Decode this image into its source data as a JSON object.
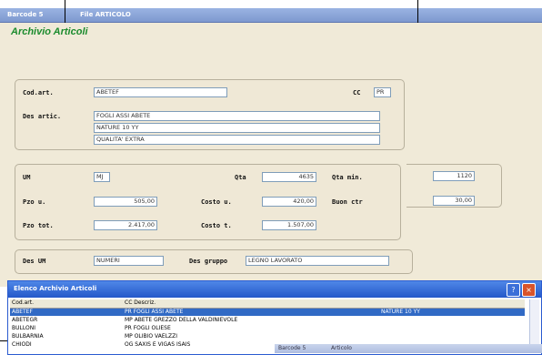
{
  "titlebar": {
    "left_text": "Barcode 5",
    "right_text": "File ARTICOLO"
  },
  "window": {
    "title": "Archivio Articoli"
  },
  "section1": {
    "cod_art_label": "Cod.art.",
    "cod_art_value": "ABETEF",
    "cc_label": "CC",
    "cc_value": "PR",
    "descr_label": "Des artic.",
    "descr_line1": "FOGLI ASSI ABETE",
    "descr_line2": "NATURE   10     YY",
    "descr_line3": "QUALITA' EXTRA"
  },
  "section2": {
    "um_label": "UM",
    "um_value": "MJ",
    "qta_label": "Qta",
    "qta_value": "4635",
    "qta_min_label": "Qta min.",
    "qta_min_value": "1120",
    "pzo_u_label": "Pzo u.",
    "pzo_u_value": "505,00",
    "costo_u_label": "Costo u.",
    "costo_u_value": "420,00",
    "buon_ctr_label": "Buon ctr",
    "buon_ctr_value": "30,00",
    "pzo_tot_label": "Pzo tot.",
    "pzo_tot_value": "2.417,00",
    "costo_t_label": "Costo t.",
    "costo_t_value": "1.507,00"
  },
  "section3": {
    "des_um_label": "Des UM",
    "des_um_value": "NUMERI",
    "des_gruppo_label": "Des gruppo",
    "des_gruppo_value": "LEGNO LAVORATO"
  },
  "popup": {
    "title": "Elenco Archivio Articoli",
    "help_icon_text": "?",
    "close_icon_text": "×",
    "columns": [
      "Cod.art.",
      "CC Descriz.",
      ""
    ],
    "rows": [
      {
        "code": "ABETEF",
        "descr": "PR FOGLI ASSI ABETE",
        "extra": "NATURE   10     YY",
        "selected": true
      },
      {
        "code": "ABETEGR",
        "descr": "MP ABETE GREZZO DELLA VALDINIEVOLE",
        "extra": "",
        "selected": false
      },
      {
        "code": "BULLONI",
        "descr": "PR FOGLI OLIESE",
        "extra": "",
        "selected": false
      },
      {
        "code": "BULBARNIA",
        "descr": "MP OLIBIO VAELZZI",
        "extra": "",
        "selected": false
      },
      {
        "code": "CHIODI",
        "descr": "OG SAXIS E VIGAS ISAIS",
        "extra": "",
        "selected": false
      }
    ]
  },
  "taskbar": {
    "left_text": "Barcode 5",
    "right_text": "Articolo"
  }
}
